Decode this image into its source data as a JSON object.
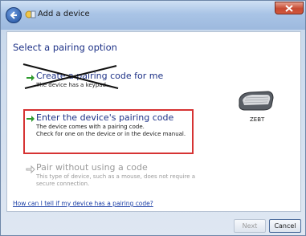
{
  "window": {
    "title": "Add a device"
  },
  "page": {
    "heading": "Select a pairing option"
  },
  "options": [
    {
      "title": "Create a pairing code for me",
      "description": "The device has a keypad.",
      "state": "struck-out"
    },
    {
      "title": "Enter the device's pairing code",
      "description_line1": "The device comes with a pairing code.",
      "description_line2": "Check for one on the device or in the device manual.",
      "state": "highlighted"
    },
    {
      "title": "Pair without using a code",
      "description_line1": "This type of device, such as a mouse, does not require a",
      "description_line2": "secure connection.",
      "state": "disabled"
    }
  ],
  "device": {
    "name": "ZEBT"
  },
  "help_link": "How can I tell if my device has a pairing code?",
  "buttons": {
    "next": "Next",
    "cancel": "Cancel"
  },
  "colors": {
    "heading": "#1e3287",
    "highlight_border": "#d63333",
    "arrow_green": "#2e9a2e"
  }
}
